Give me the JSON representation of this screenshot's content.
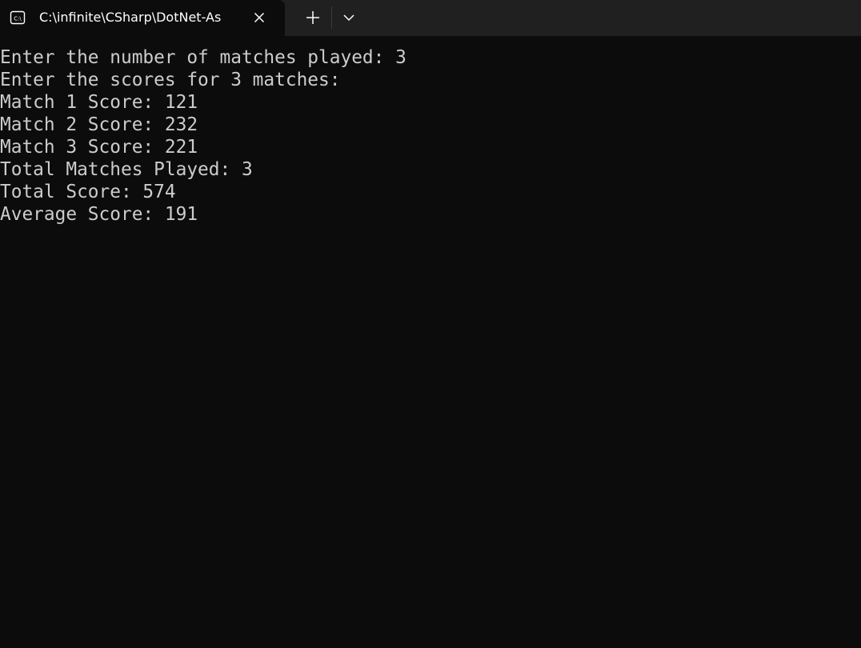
{
  "tab": {
    "title": "C:\\infinite\\CSharp\\DotNet-As",
    "icon": "terminal-icon",
    "close_icon": "close-icon"
  },
  "toolbar": {
    "new_tab_icon": "plus-icon",
    "dropdown_icon": "chevron-down-icon"
  },
  "terminal": {
    "lines": [
      "Enter the number of matches played: 3",
      "Enter the scores for 3 matches:",
      "Match 1 Score: 121",
      "Match 2 Score: 232",
      "Match 3 Score: 221",
      "Total Matches Played: 3",
      "Total Score: 574",
      "Average Score: 191"
    ]
  },
  "colors": {
    "background": "#0c0c0c",
    "titlebar": "#202020",
    "text": "#cccccc"
  }
}
